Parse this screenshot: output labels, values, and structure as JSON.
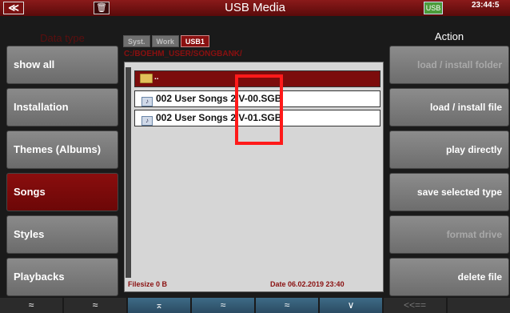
{
  "window": {
    "title": "USB Media",
    "back_icon": "≪",
    "trash_icon": "🗑",
    "usb_icon_label": "USB",
    "clock": "23:44:5"
  },
  "left": {
    "header": "Data type",
    "items": [
      {
        "label": "show all"
      },
      {
        "label": "Installation"
      },
      {
        "label": "Themes (Albums)"
      },
      {
        "label": "Songs",
        "active": true
      },
      {
        "label": "Styles"
      },
      {
        "label": "Playbacks"
      }
    ]
  },
  "center": {
    "tabs": [
      {
        "label": "Syst."
      },
      {
        "label": "Work"
      },
      {
        "label": "USB1",
        "active": true
      }
    ],
    "path": "C:/BOEHM_USER/SONGBANK/",
    "folder_up_label": "..",
    "files": [
      {
        "name": "002 User Songs 2 V-00.SGB"
      },
      {
        "name": "002 User Songs 2 V-01.SGB"
      }
    ],
    "filesize": "Filesize 0 B",
    "date": "Date 06.02.2019  23:40"
  },
  "right": {
    "header": "Action",
    "items": [
      {
        "label": "load  /  install folder",
        "dim": true
      },
      {
        "label": "load  /  install file"
      },
      {
        "label": "play directly"
      },
      {
        "label": "save selected type"
      },
      {
        "label": "format drive",
        "dim": true
      },
      {
        "label": "delete file"
      }
    ]
  },
  "bottom": [
    {
      "label": "≈"
    },
    {
      "label": "≈"
    },
    {
      "label": "⌅",
      "blue": true
    },
    {
      "label": "≈",
      "blue": true
    },
    {
      "label": "≈",
      "blue": true
    },
    {
      "label": "∨",
      "blue": true
    },
    {
      "label": "<<==",
      "dim": true
    },
    {
      "label": "",
      "dim": true
    }
  ],
  "colors": {
    "accent_red": "#8a1010",
    "highlight_box": "#ff1a1a",
    "nav_blue": "#3e6b87"
  }
}
